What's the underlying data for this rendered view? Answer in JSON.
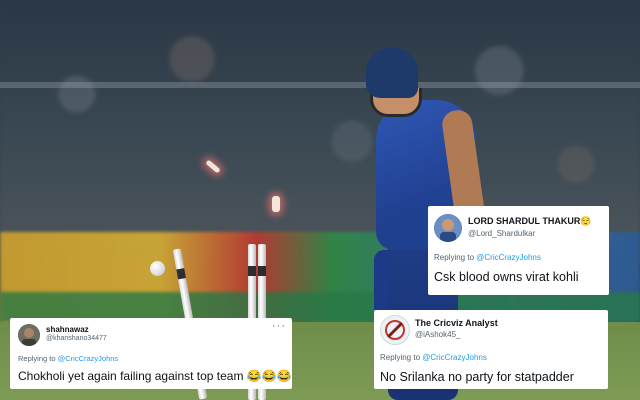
{
  "tweets": [
    {
      "name": "LORD SHARDUL THAKUR😌",
      "handle": "@Lord_Shardulkar",
      "replying_prefix": "Replying to",
      "replying_to": "@CricCrazyJohns",
      "text": "Csk blood owns virat kohli"
    },
    {
      "name": "The Cricviz Analyst",
      "handle": "@iAshok45_",
      "replying_prefix": "Replying to",
      "replying_to": "@CricCrazyJohns",
      "text": "No Srilanka no party for statpadder"
    },
    {
      "name": "shahnawaz",
      "handle": "@khanshano34477",
      "replying_prefix": "Replying to",
      "replying_to": "@CricCrazyJohns",
      "text": "Chokholi yet again failing against top team 😂😂😂",
      "more_menu": "···"
    }
  ]
}
